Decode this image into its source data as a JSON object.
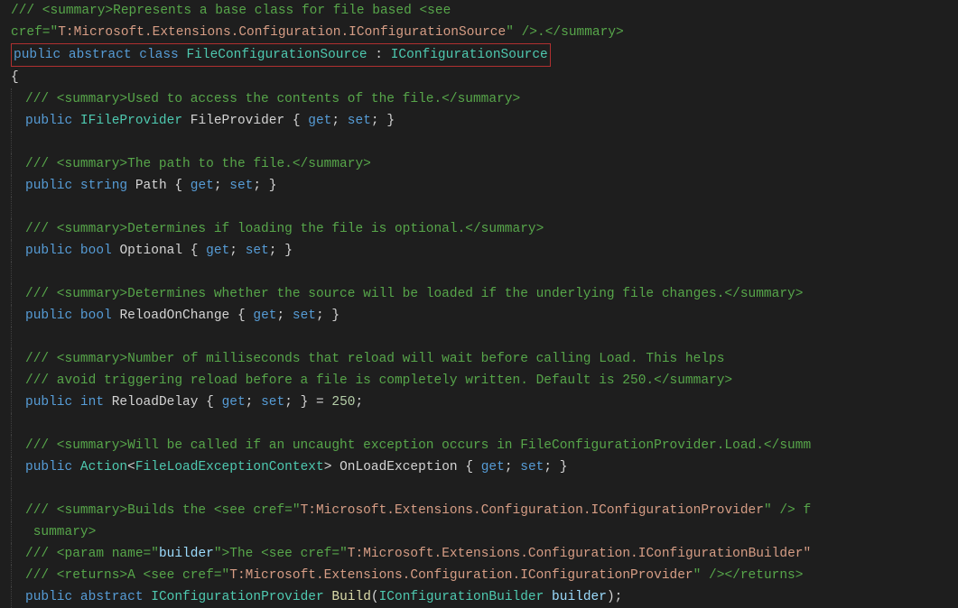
{
  "lines": {
    "l1a": "/// <summary>Represents a base class for file based <see",
    "l1b_pre": "    cref=\"",
    "l1b_str": "T:Microsoft.Extensions.Configuration.IConfigurationSource",
    "l1b_post": "\" />.</summary>",
    "decl_kw_public": "public",
    "decl_kw_abstract": "abstract",
    "decl_kw_class": "class",
    "decl_type": "FileConfigurationSource",
    "decl_colon": " : ",
    "decl_base": "IConfigurationSource",
    "brace_open": "{",
    "c_fp": "/// <summary>Used to access the contents of the file.</summary>",
    "fp_type": "IFileProvider",
    "fp_name": "FileProvider",
    "c_path": "/// <summary>The path to the file.</summary>",
    "path_type": "string",
    "path_name": "Path",
    "c_opt": "/// <summary>Determines if loading the file is optional.</summary>",
    "opt_type": "bool",
    "opt_name": "Optional",
    "c_reload": "/// <summary>Determines whether the source will be loaded if the underlying file changes.</summary>",
    "reload_type": "bool",
    "reload_name": "ReloadOnChange",
    "c_delay1": "/// <summary>Number of milliseconds that reload will wait before calling Load.  This helps",
    "c_delay2": "/// avoid triggering reload before a file is completely written. Default is 250.</summary>",
    "delay_type": "int",
    "delay_name": "ReloadDelay",
    "delay_val": "250",
    "c_onload": "/// <summary>Will be called if an uncaught exception occurs in FileConfigurationProvider.Load.</summ",
    "onload_type1": "Action",
    "onload_type2": "FileLoadExceptionContext",
    "onload_name": "OnLoadException",
    "c_build1_pre": "/// <summary>Builds the <see cref=\"",
    "c_build1_str": "T:Microsoft.Extensions.Configuration.IConfigurationProvider",
    "c_build1_post": "\" /> f",
    "c_build2": "    summary>",
    "c_build3_pre": "/// <param name=\"",
    "c_build3_name": "builder",
    "c_build3_mid": "\">The <see cref=\"",
    "c_build3_str": "T:Microsoft.Extensions.Configuration.IConfigurationBuilder\"",
    "c_build4_pre": "/// <returns>A <see cref=\"",
    "c_build4_str": "T:Microsoft.Extensions.Configuration.IConfigurationProvider",
    "c_build4_post": "\" /></returns>",
    "build_ret": "IConfigurationProvider",
    "build_name": "Build",
    "build_ptype": "IConfigurationBuilder",
    "build_pname": "builder",
    "get": "get",
    "set": "set"
  }
}
